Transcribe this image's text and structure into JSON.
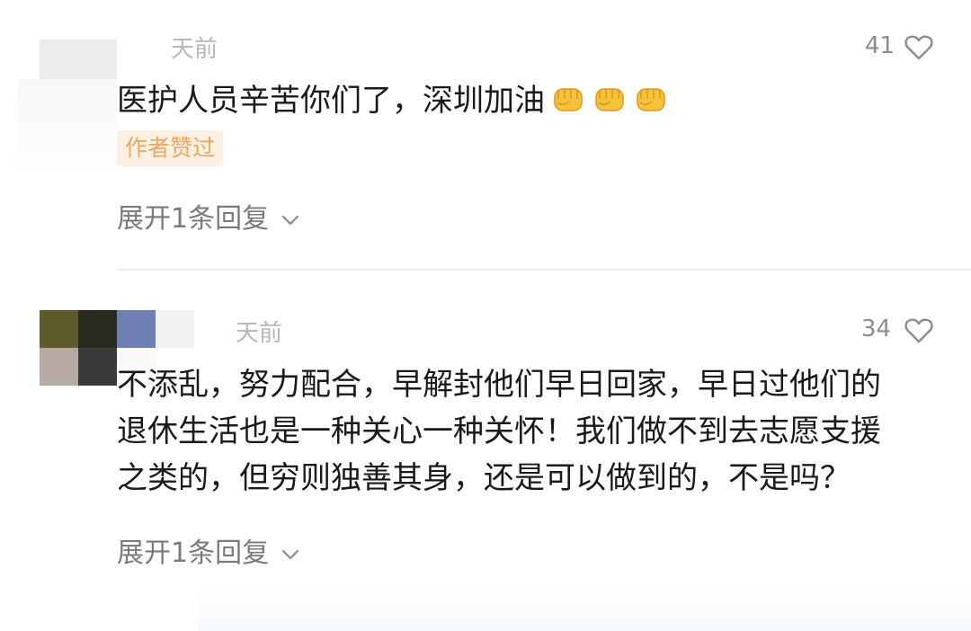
{
  "comments": [
    {
      "time": "天前",
      "likes": "41",
      "text": "医护人员辛苦你们了，深圳加油",
      "emoji_count": 3,
      "badge": "作者赞过",
      "expand": "展开1条回复"
    },
    {
      "time": "天前",
      "likes": "34",
      "lines": [
        "不添乱，努力配合，早解封他们早日回家，早日过他们的",
        "退休生活也是一种关心一种关怀！我们做不到去志愿支援",
        "之类的，但穷则独善其身，还是可以做到的，不是吗？"
      ],
      "expand": "展开1条回复"
    }
  ],
  "colors": {
    "text": "#1a1a1a",
    "muted": "#7a7a7a",
    "badge_bg": "#fbf0e2",
    "badge_text": "#e8a763",
    "emoji": "#f7c23b"
  },
  "icons": {
    "like": "heart-outline-icon",
    "expand": "chevron-down-icon",
    "reaction": "raised-fist-emoji"
  }
}
